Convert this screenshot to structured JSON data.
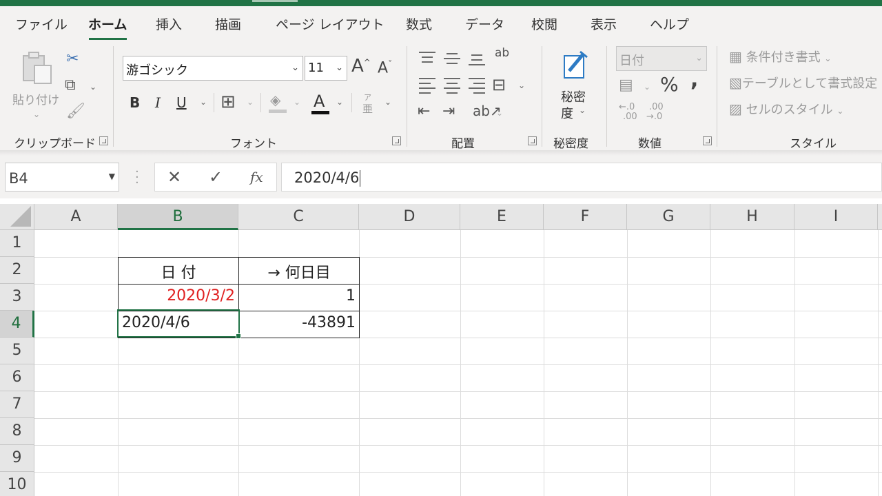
{
  "tabs": [
    "ファイル",
    "ホーム",
    "挿入",
    "描画",
    "ページ レイアウト",
    "数式",
    "データ",
    "校閲",
    "表示",
    "ヘルプ"
  ],
  "active_tab": "ホーム",
  "clipboard": {
    "paste": "貼り付け",
    "label": "クリップボード"
  },
  "font": {
    "name": "游ゴシック",
    "size": "11",
    "bold": "B",
    "italic": "I",
    "underline": "U",
    "color_letter": "A",
    "phonetic_top": "ア",
    "phonetic_bottom": "亜",
    "grow": "A",
    "shrink": "A",
    "label": "フォント"
  },
  "alignment": {
    "label": "配置",
    "wrap": "ab"
  },
  "sensitivity": {
    "line1": "秘密",
    "line2": "度",
    "label": "秘密度"
  },
  "number": {
    "format": "日付",
    "percent": "%",
    "comma": ",",
    "inc_top": "←.0",
    "inc_bottom": ".00",
    "dec_top": ".00",
    "dec_bottom": "→.0",
    "label": "数値"
  },
  "styles": {
    "conditional": "条件付き書式",
    "table": "テーブルとして書式設定",
    "cell": "セルのスタイル",
    "label": "スタイル"
  },
  "formula_bar": {
    "name_box": "B4",
    "cancel": "✕",
    "enter": "✓",
    "fx": "fx",
    "value": "2020/4/6"
  },
  "columns": [
    "A",
    "B",
    "C",
    "D",
    "E",
    "F",
    "G",
    "H",
    "I"
  ],
  "selected_column": "B",
  "rows": [
    "1",
    "2",
    "3",
    "4",
    "5",
    "6",
    "7",
    "8",
    "9",
    "10"
  ],
  "selected_row": "4",
  "cells": {
    "B2": "日 付",
    "C2": "→ 何日目",
    "B3": "2020/3/2",
    "C3": "1",
    "B4": "2020/4/6",
    "C4": "-43891"
  },
  "colors": {
    "accent": "#217346",
    "red_text": "#e02020"
  }
}
